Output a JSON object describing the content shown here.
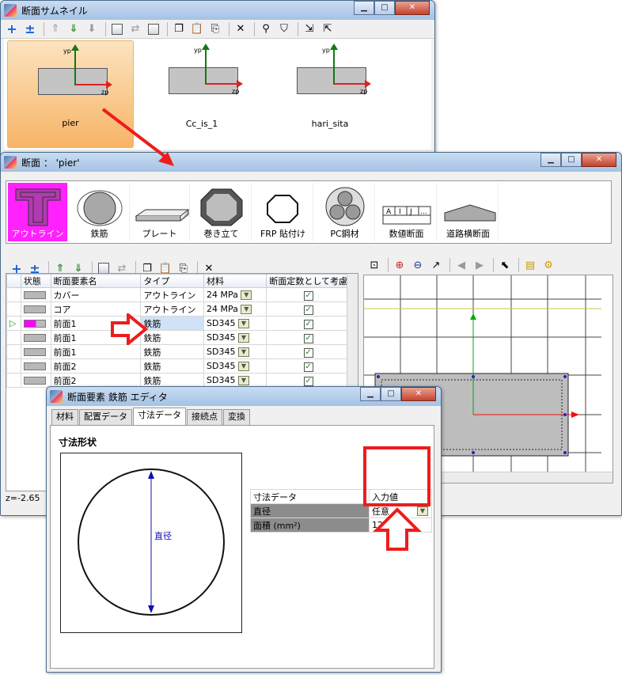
{
  "thumbnail_window": {
    "title": "断面サムネイル",
    "thumbnails": [
      {
        "name": "pier",
        "yp": "yp",
        "zp": "zp"
      },
      {
        "name": "Cc_is_1",
        "yp": "yp",
        "zp": "zp"
      },
      {
        "name": "hari_sita",
        "yp": "yp",
        "zp": "zp"
      }
    ]
  },
  "section_window": {
    "title": "断面 ： 'pier'",
    "categories": [
      "アウトライン",
      "鉄筋",
      "プレート",
      "巻き立て",
      "FRP 貼付け",
      "PC鋼材",
      "数値断面",
      "道路横断面"
    ],
    "numeric_icon_letters": [
      "A",
      "I",
      "J",
      "..."
    ],
    "grid_headers": [
      "状態",
      "断面要素名",
      "タイプ",
      "材料",
      "断面定数として考慮"
    ],
    "rows": [
      {
        "name": "カバー",
        "type": "アウトライン",
        "material": "24 MPa",
        "checked": "✓"
      },
      {
        "name": "コア",
        "type": "アウトライン",
        "material": "24 MPa",
        "checked": "✓"
      },
      {
        "name": "前面1",
        "type": "鉄筋",
        "material": "SD345",
        "checked": "✓"
      },
      {
        "name": "前面1",
        "type": "鉄筋",
        "material": "SD345",
        "checked": "✓"
      },
      {
        "name": "前面1",
        "type": "鉄筋",
        "material": "SD345",
        "checked": "✓"
      },
      {
        "name": "前面2",
        "type": "鉄筋",
        "material": "SD345",
        "checked": "✓"
      },
      {
        "name": "前面2",
        "type": "鉄筋",
        "material": "SD345",
        "checked": "✓"
      }
    ],
    "status_text": "z=-2.65"
  },
  "editor_window": {
    "title": "断面要素 鉄筋 エディタ",
    "tabs": [
      "材料",
      "配置データ",
      "寸法データ",
      "接続点",
      "変換"
    ],
    "section_heading": "寸法形状",
    "diagram_label": "直径",
    "dim_table": {
      "header_data": "寸法データ",
      "header_value": "入力値",
      "rows": [
        {
          "label": "直径",
          "value": "任意"
        },
        {
          "label": "面積 (mm²)",
          "value": "123.5"
        }
      ]
    }
  },
  "colors": {
    "accent_red": "#ee1c1c",
    "selected_category": "#ff22ff",
    "thumb_selected": "#f7b466"
  }
}
